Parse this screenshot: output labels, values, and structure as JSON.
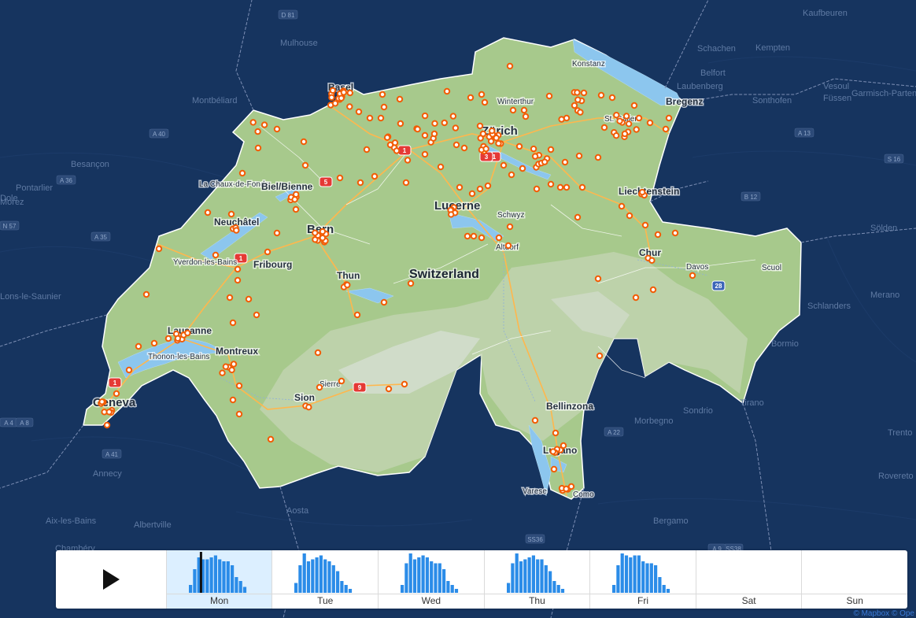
{
  "map": {
    "country_label": "Switzerland",
    "cities": [
      {
        "name": "Basel",
        "cls": "city"
      },
      {
        "name": "Winterthur",
        "cls": "city city-small"
      },
      {
        "name": "Zürich",
        "cls": "city city-big"
      },
      {
        "name": "St. Gallen",
        "cls": "city city-small"
      },
      {
        "name": "Bregenz",
        "cls": "city"
      },
      {
        "name": "Konstanz",
        "cls": "city city-small"
      },
      {
        "name": "Liechtenstein",
        "cls": "city"
      },
      {
        "name": "La Chaux-de-Fonds",
        "cls": "city city-small"
      },
      {
        "name": "Biel/Bienne",
        "cls": "city"
      },
      {
        "name": "Neuchâtel",
        "cls": "city"
      },
      {
        "name": "Bern",
        "cls": "city city-big"
      },
      {
        "name": "Lucerne",
        "cls": "city city-big"
      },
      {
        "name": "Schwyz",
        "cls": "city city-small"
      },
      {
        "name": "Altdorf",
        "cls": "city city-small"
      },
      {
        "name": "Chur",
        "cls": "city"
      },
      {
        "name": "Davos",
        "cls": "city city-small"
      },
      {
        "name": "Scuol",
        "cls": "city city-small"
      },
      {
        "name": "Yverdon-les-Bains",
        "cls": "city city-small"
      },
      {
        "name": "Fribourg",
        "cls": "city"
      },
      {
        "name": "Thun",
        "cls": "city"
      },
      {
        "name": "Lausanne",
        "cls": "city"
      },
      {
        "name": "Thonon-les-Bains",
        "cls": "city city-small"
      },
      {
        "name": "Montreux",
        "cls": "city"
      },
      {
        "name": "Geneva",
        "cls": "city city-big"
      },
      {
        "name": "Sierre",
        "cls": "city city-small"
      },
      {
        "name": "Sion",
        "cls": "city"
      },
      {
        "name": "Bellinzona",
        "cls": "city"
      },
      {
        "name": "Lugano",
        "cls": "city"
      },
      {
        "name": "Varese",
        "cls": "city city-small"
      },
      {
        "name": "Como",
        "cls": "city city-small"
      }
    ],
    "outer_labels": [
      "Kaufbeuren",
      "Mulhouse",
      "Schachen",
      "Kempten",
      "Belfort",
      "Vesoul",
      "Laubenberg",
      "Füssen",
      "Montbéliard",
      "Sonthofen",
      "Garmisch-Partenkirchen",
      "Besançon",
      "Pontarlier",
      "Morez",
      "Lons-le-Saunier",
      "Annecy",
      "Aix-les-Bains",
      "Aosta",
      "Bergamo",
      "Sondrio",
      "Trento",
      "Rovereto",
      "Schlanders",
      "Bormio",
      "Merano",
      "Tirano",
      "Morbegno",
      "Albertville",
      "Chambéry",
      "Sölden",
      "Dole",
      "D 81",
      "A 36",
      "N 57",
      "A 40",
      "A 41",
      "A 35",
      "B 12",
      "S 16",
      "A 13",
      "A 22",
      "SS36",
      "SS38",
      "A 9",
      "A 4",
      "A 8"
    ],
    "shields": [
      "1",
      "5",
      "1",
      "1",
      "9",
      "28",
      "1",
      "3"
    ]
  },
  "timeline": {
    "play_icon": "play-icon",
    "selected_day": "Mon",
    "days": [
      {
        "label": "Mon",
        "values": [
          4,
          12,
          18,
          17,
          17,
          18,
          19,
          17,
          16,
          16,
          14,
          8,
          6,
          3
        ]
      },
      {
        "label": "Tue",
        "values": [
          5,
          14,
          20,
          16,
          17,
          18,
          19,
          17,
          16,
          14,
          11,
          6,
          4,
          2
        ]
      },
      {
        "label": "Wed",
        "values": [
          4,
          15,
          20,
          17,
          18,
          19,
          18,
          16,
          15,
          15,
          12,
          6,
          4,
          2
        ]
      },
      {
        "label": "Thu",
        "values": [
          5,
          15,
          20,
          16,
          17,
          18,
          19,
          17,
          17,
          14,
          11,
          6,
          4,
          2
        ]
      },
      {
        "label": "Fri",
        "values": [
          4,
          14,
          20,
          19,
          18,
          19,
          19,
          16,
          15,
          15,
          14,
          8,
          4,
          2
        ]
      },
      {
        "label": "Sat",
        "values": []
      },
      {
        "label": "Sun",
        "values": []
      }
    ],
    "bar_color": "#2b8ce8",
    "marker_color": "#111111"
  },
  "attribution": "© Mapbox © Ope",
  "colors": {
    "ocean": "#16345f",
    "land": "#a9c98f",
    "marker": "#f25c05",
    "highway": "#ffb74d",
    "lake": "#8cc6ee"
  }
}
